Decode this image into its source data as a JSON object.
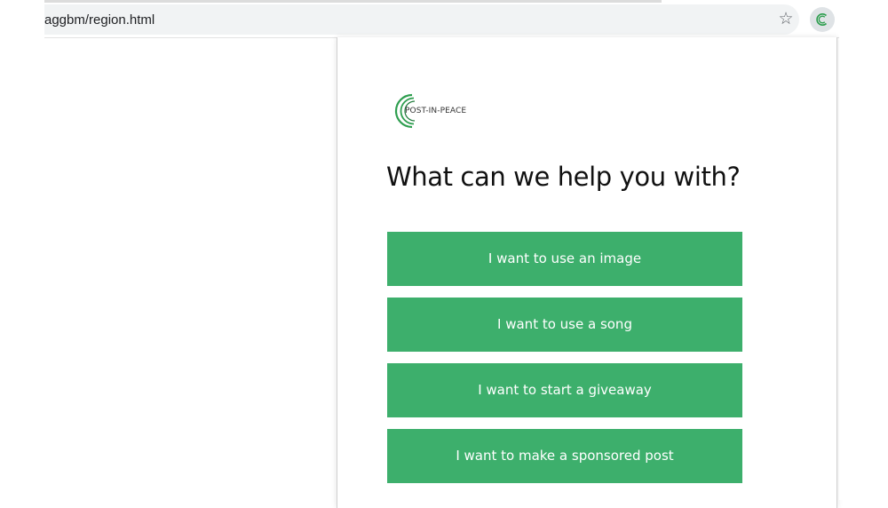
{
  "browser": {
    "url": "aggbm/region.html",
    "star_icon": "★",
    "extension_icon_glyph": "C"
  },
  "popup": {
    "logo_text": "POST-IN-PEACE",
    "headline": "What can we help you with?",
    "options": [
      {
        "label": "I want to use an image"
      },
      {
        "label": "I want to use a song"
      },
      {
        "label": "I want to start a giveaway"
      },
      {
        "label": "I want to make a sponsored post"
      }
    ]
  },
  "colors": {
    "accent_green": "#3daf6c",
    "logo_green": "#2e9e4f",
    "omnibox_bg": "#f1f3f4"
  }
}
